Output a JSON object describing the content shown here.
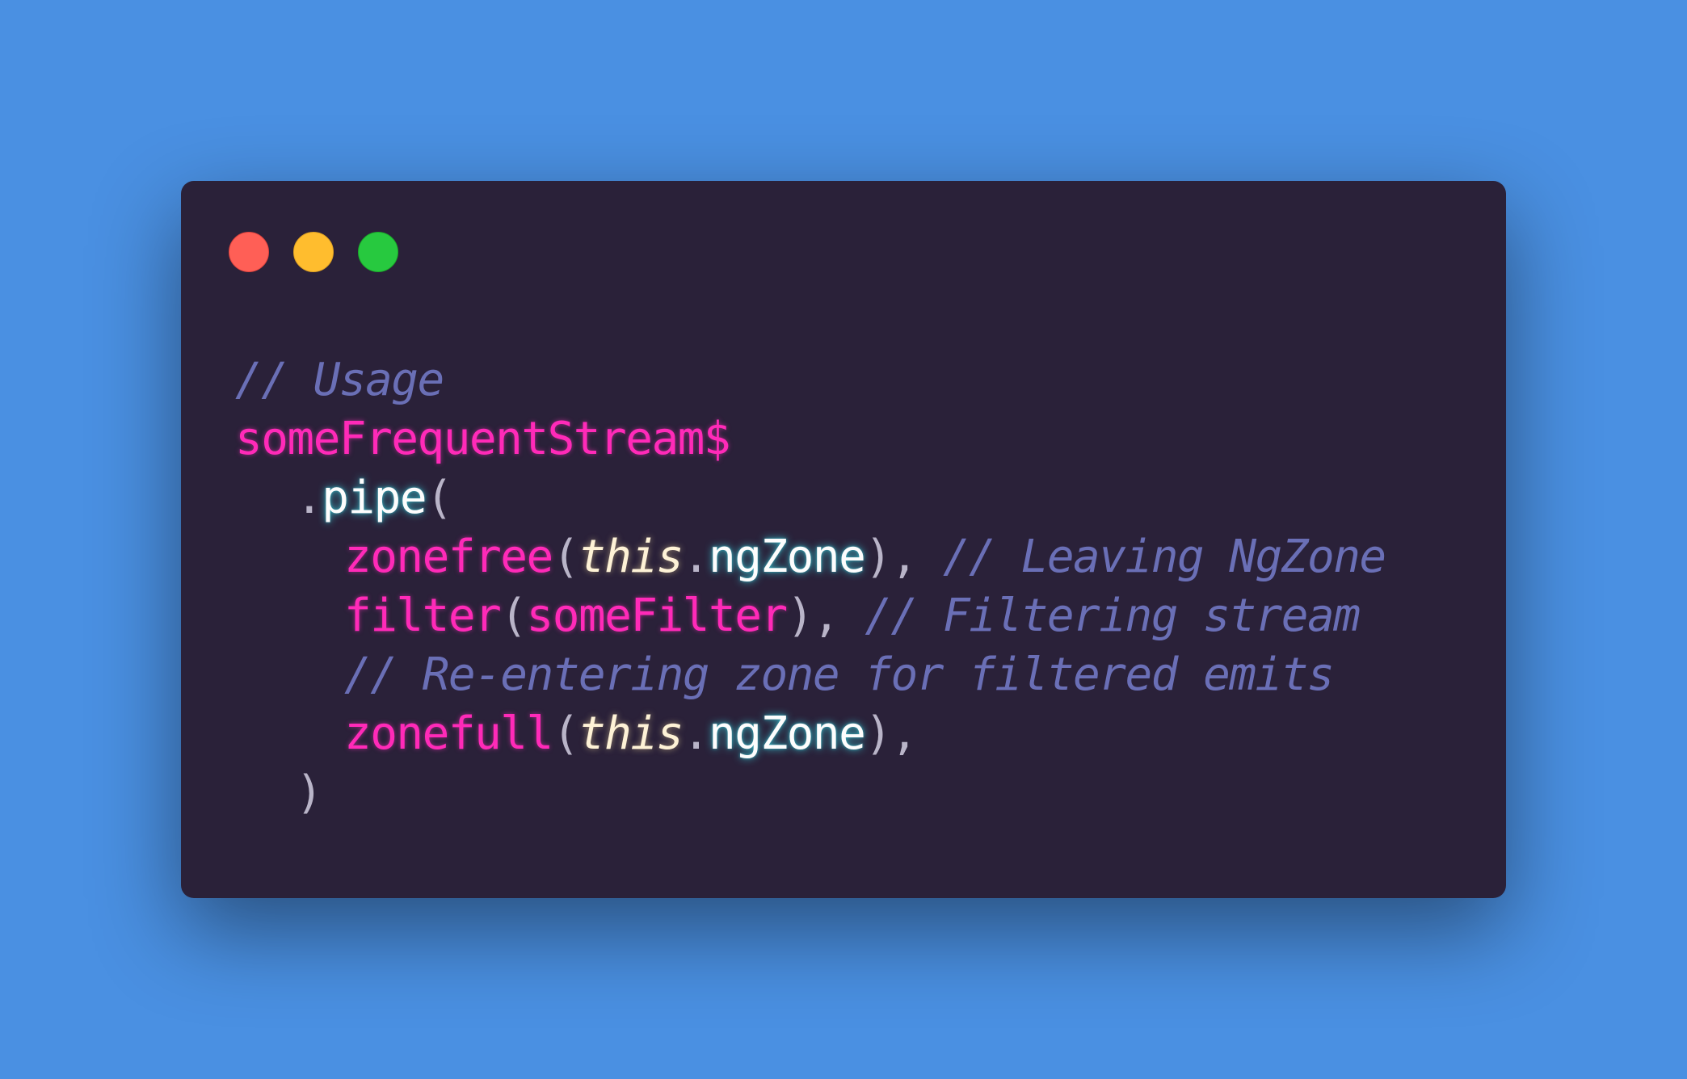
{
  "window": {
    "controls": [
      {
        "name": "close",
        "color": "#ff5f56"
      },
      {
        "name": "minimize",
        "color": "#ffbd2e"
      },
      {
        "name": "maximize",
        "color": "#27c93f"
      }
    ]
  },
  "code": {
    "line1": {
      "comment": "// Usage"
    },
    "line2": {
      "var": "someFrequentStream$"
    },
    "line3": {
      "dot": ".",
      "method": "pipe",
      "open": "("
    },
    "line4": {
      "fn": "zonefree",
      "open": "(",
      "this": "this",
      "dot": ".",
      "prop": "ngZone",
      "close": "),",
      "comment": "// Leaving NgZone"
    },
    "line5": {
      "fn": "filter",
      "open": "(",
      "arg": "someFilter",
      "close": "),",
      "comment": "// Filtering stream"
    },
    "line6": {
      "comment": "// Re-entering zone for filtered emits"
    },
    "line7": {
      "fn": "zonefull",
      "open": "(",
      "this": "this",
      "dot": ".",
      "prop": "ngZone",
      "close": "),"
    },
    "line8": {
      "close": ")"
    }
  },
  "colors": {
    "background": "#4a90e2",
    "window": "#2a2139",
    "keyword_pink": "#ff2ab8",
    "comment": "#6a6fb6"
  }
}
